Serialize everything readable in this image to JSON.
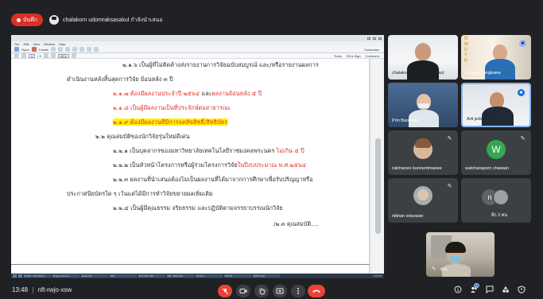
{
  "topbar": {
    "record_label": "บันทึก",
    "presenter_text": "chalakorn udomraksasakul กำลังนำเสนอ"
  },
  "screen": {
    "window_title": "",
    "menu": [
      "File",
      "Edit",
      "View",
      "Window",
      "Help"
    ],
    "toolbar": {
      "open_label": "Open",
      "create_label": "Create",
      "tools_label": "Tools",
      "fill_sign_label": "Fill & Sign",
      "comment_label": "Comment",
      "page_box": "9",
      "page_total": "/ 9",
      "zoom": "99%",
      "customize_label": "Customize"
    },
    "lines": [
      {
        "text": "๒.๑.๖ เป็นผู้ที่ไม่ติดค้างส่งรายงานการวิจัยฉบับสมบูรณ์ และ/หรือรายงานผลการ",
        "style": "normal"
      },
      {
        "text": "ดำเนินงานหลังสิ้นสุดการวิจัย ย้อนหลัง ๓ ปี",
        "style": "normal"
      },
      {
        "pre": "๒.๑.๗ ต้องมีผลงานประจำปี ๒๕๖๔",
        "mid": " และ",
        "post": "ผลงานย้อนหลัง ๕ ปี",
        "style": "mixed"
      },
      {
        "text": "๒.๑.๘ เป็นผู้มีผลงานเป็นที่ประจักษ์ต่อสาธารณะ",
        "style": "red"
      },
      {
        "text": "๒.๑.๙ ต้องมีผลงานที่มีการจดลิขสิทธิ์/สิทธิบัตร",
        "style": "highlight"
      },
      {
        "text": "๒.๒ คุณสมบัติของนักวิจัยรุ่นใหม่ดีเด่น",
        "style": "normal"
      },
      {
        "pre": "๒.๒.๑ เป็นบุคลากรของมหาวิทยาลัยเทคโนโลยีราชมงคลพระนคร ",
        "post": "ไม่เกิน ๕ ปี",
        "style": "tail-red"
      },
      {
        "pre": "๒.๒.๒ เป็นหัวหน้าโครงการหรือผู้ร่วมโครงการวิจัย",
        "post": "ในปีงบประมาณ พ.ศ.๒๕๖๔",
        "style": "tail-red"
      },
      {
        "text": "๒.๒.๓ ผลงานที่นำเสนอต้องไม่เป็นผลงานที่ได้มาจากการศึกษาเพื่อรับปริญญาหรือ",
        "style": "normal"
      },
      {
        "text": "ประกาศนียบัตรใด ๆ เว้นแต่ได้มีการทำวิจัยขยายผลเพิ่มเติม",
        "style": "normal"
      },
      {
        "text": "๒.๒.๔ เป็นผู้มีคุณธรรม จริยธรรม และปฏิบัติตามจรรยาบรรณนักวิจัย",
        "style": "normal"
      },
      {
        "text": "/๒.๓ คุณสมบัติ....",
        "style": "normal"
      }
    ],
    "taskbar_apps": [
      "ประชุม - MS Teams",
      "Google Chrome",
      "Adobe Re...",
      "PDF",
      "ประกาศ rmutp",
      "วิจัย - Microsoft",
      "Chrome",
      "รายงาน",
      "เอกสาร.pdf"
    ],
    "taskbar_time": "1:45 PM"
  },
  "participants": [
    {
      "name": "chalakorn udomraksasakul",
      "kind": "video",
      "muted": false
    },
    {
      "name": "Jompol Kongkaew",
      "kind": "video",
      "muted": false
    },
    {
      "name": "Prin Boonkerd",
      "kind": "video",
      "muted": false
    },
    {
      "name": "Arti jedwanna",
      "kind": "video",
      "muted": false,
      "speaking": true
    },
    {
      "name": "ratchaneo kunnerdmanee",
      "kind": "photo",
      "muted": true
    },
    {
      "name": "watcharaporn chaiwan",
      "kind": "letter",
      "letter": "W",
      "muted": true
    },
    {
      "name": "nitinan srisuwan",
      "kind": "photo",
      "muted": true
    },
    {
      "name": "อีก 3 คน",
      "kind": "more",
      "letter": "n",
      "muted": false
    },
    {
      "name": "คุณ",
      "kind": "self",
      "muted": true
    }
  ],
  "bottombar": {
    "time": "13:48",
    "meeting_code": "nft-rwjo-xsw",
    "people_badge": "12"
  },
  "colors": {
    "meet_bg": "#202124",
    "tile_bg": "#3c4043",
    "red": "#ea4335",
    "highlight": "#fff200",
    "doc_red": "#e0352b"
  },
  "icons": {
    "record": "record-dot-icon",
    "presenter": "present-screen-icon",
    "mic": "mic-off-icon",
    "camera": "camera-icon",
    "hand": "raise-hand-icon",
    "present": "present-icon",
    "more": "more-vert-icon",
    "hangup": "hangup-icon",
    "info": "info-icon",
    "people": "people-icon",
    "chat": "chat-icon",
    "activities": "activities-icon",
    "host": "host-controls-icon"
  }
}
